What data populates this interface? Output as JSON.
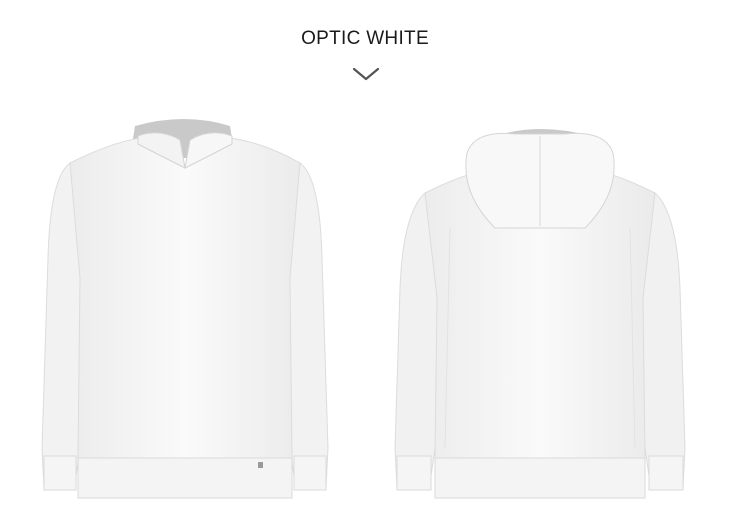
{
  "header": {
    "color_name": "OPTIC WHITE",
    "chevron_icon": "chevron-down-icon"
  },
  "gallery": {
    "items": [
      {
        "view": "front",
        "description_icon": "hoodie-front-image"
      },
      {
        "view": "back",
        "description_icon": "hoodie-back-image"
      }
    ],
    "garment_color": "#f7f7f7",
    "hood_lining_color": "#c9c9c9"
  }
}
